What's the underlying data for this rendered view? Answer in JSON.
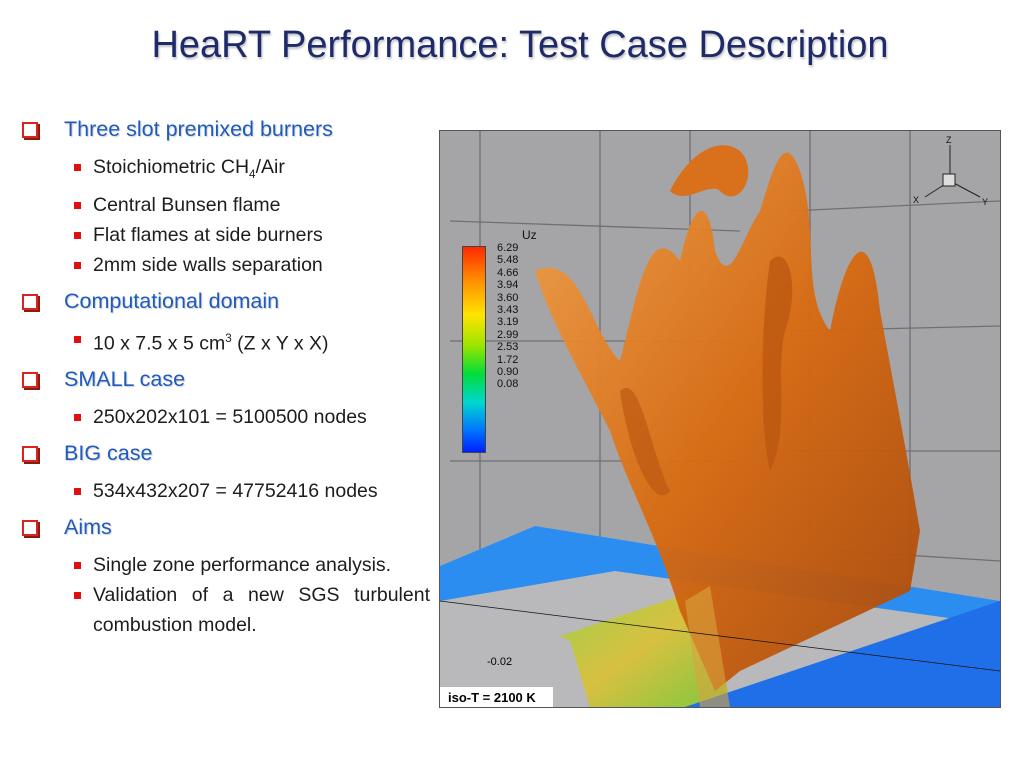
{
  "slide": {
    "title": "HeaRT Performance: Test Case Description"
  },
  "bullets": [
    {
      "label": "Three slot premixed burners",
      "items": [
        {
          "pre": "Stoichiometric CH",
          "sub": "4",
          "post": "/Air"
        },
        {
          "text": "Central Bunsen flame"
        },
        {
          "text": "Flat flames at side burners"
        },
        {
          "text": "2mm side walls separation"
        }
      ]
    },
    {
      "label": "Computational domain",
      "items": [
        {
          "pre": "10 x 7.5 x 5 cm",
          "sup": "3",
          "post": " (Z x Y x X)"
        }
      ]
    },
    {
      "label": "SMALL case",
      "items": [
        {
          "text": "250x202x101 = 5100500 nodes"
        }
      ]
    },
    {
      "label": "BIG case",
      "items": [
        {
          "text": "534x432x207 = 47752416 nodes"
        }
      ]
    },
    {
      "label": "Aims",
      "items": [
        {
          "text": "Single zone performance analysis."
        },
        {
          "text": "Validation of a new SGS turbulent combustion model."
        }
      ]
    }
  ],
  "figure": {
    "legend_title": "Uz",
    "legend_values": [
      "6.29",
      "5.48",
      "4.66",
      "3.94",
      "3.60",
      "3.43",
      "3.19",
      "2.99",
      "2.53",
      "1.72",
      "0.90",
      "0.08"
    ],
    "axis_label_z": "Z",
    "axis_label_x": "X",
    "axis_label_y": "Y",
    "tick_label": "-0.02",
    "iso_label": "iso-T = 2100 K"
  }
}
